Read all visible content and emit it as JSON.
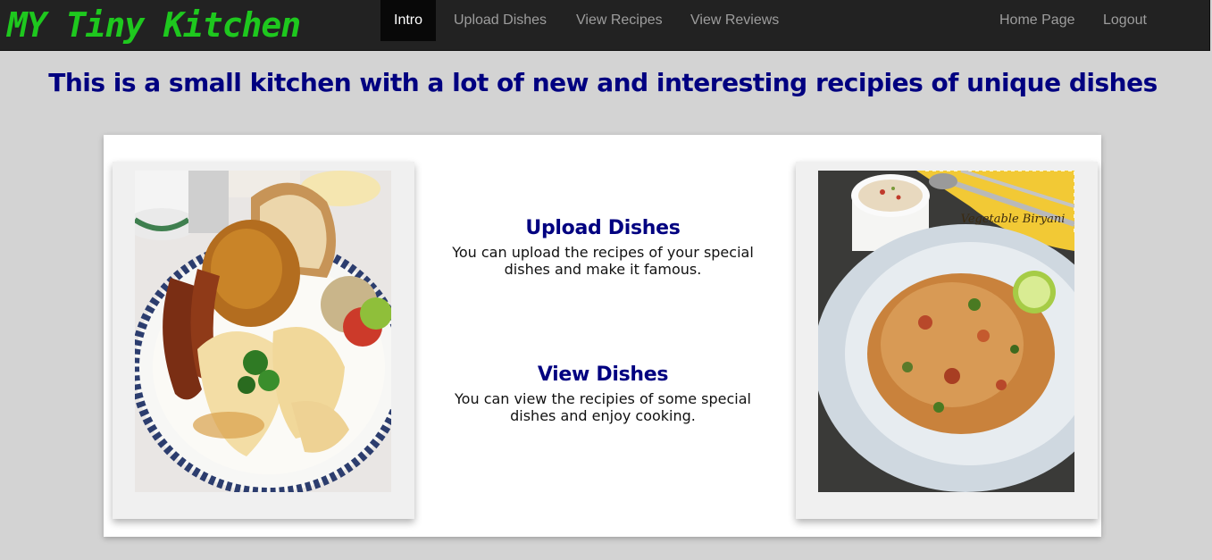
{
  "brand": "MY Tiny Kitchen",
  "nav": {
    "left": [
      {
        "label": "Intro",
        "active": true
      },
      {
        "label": "Upload Dishes",
        "active": false
      },
      {
        "label": "View Recipes",
        "active": false
      },
      {
        "label": "View Reviews",
        "active": false
      }
    ],
    "right": [
      {
        "label": "Home Page"
      },
      {
        "label": "Logout"
      }
    ]
  },
  "headline": "This is a small kitchen with a lot of new and interesting recipies of unique dishes",
  "features": [
    {
      "title": "Upload Dishes",
      "desc": "You can upload the recipes of your special dishes and make it famous."
    },
    {
      "title": "View Dishes",
      "desc": "You can view the recipies of some special dishes and enjoy cooking."
    }
  ],
  "photos": {
    "left": {
      "icon": "food-plate-photo"
    },
    "right": {
      "icon": "biryani-plate-photo",
      "caption": "Vegetable Biryani"
    }
  },
  "colors": {
    "brand": "#1ec81e",
    "navbar": "#222222",
    "heading": "#000080",
    "background": "#d3d3d3"
  }
}
